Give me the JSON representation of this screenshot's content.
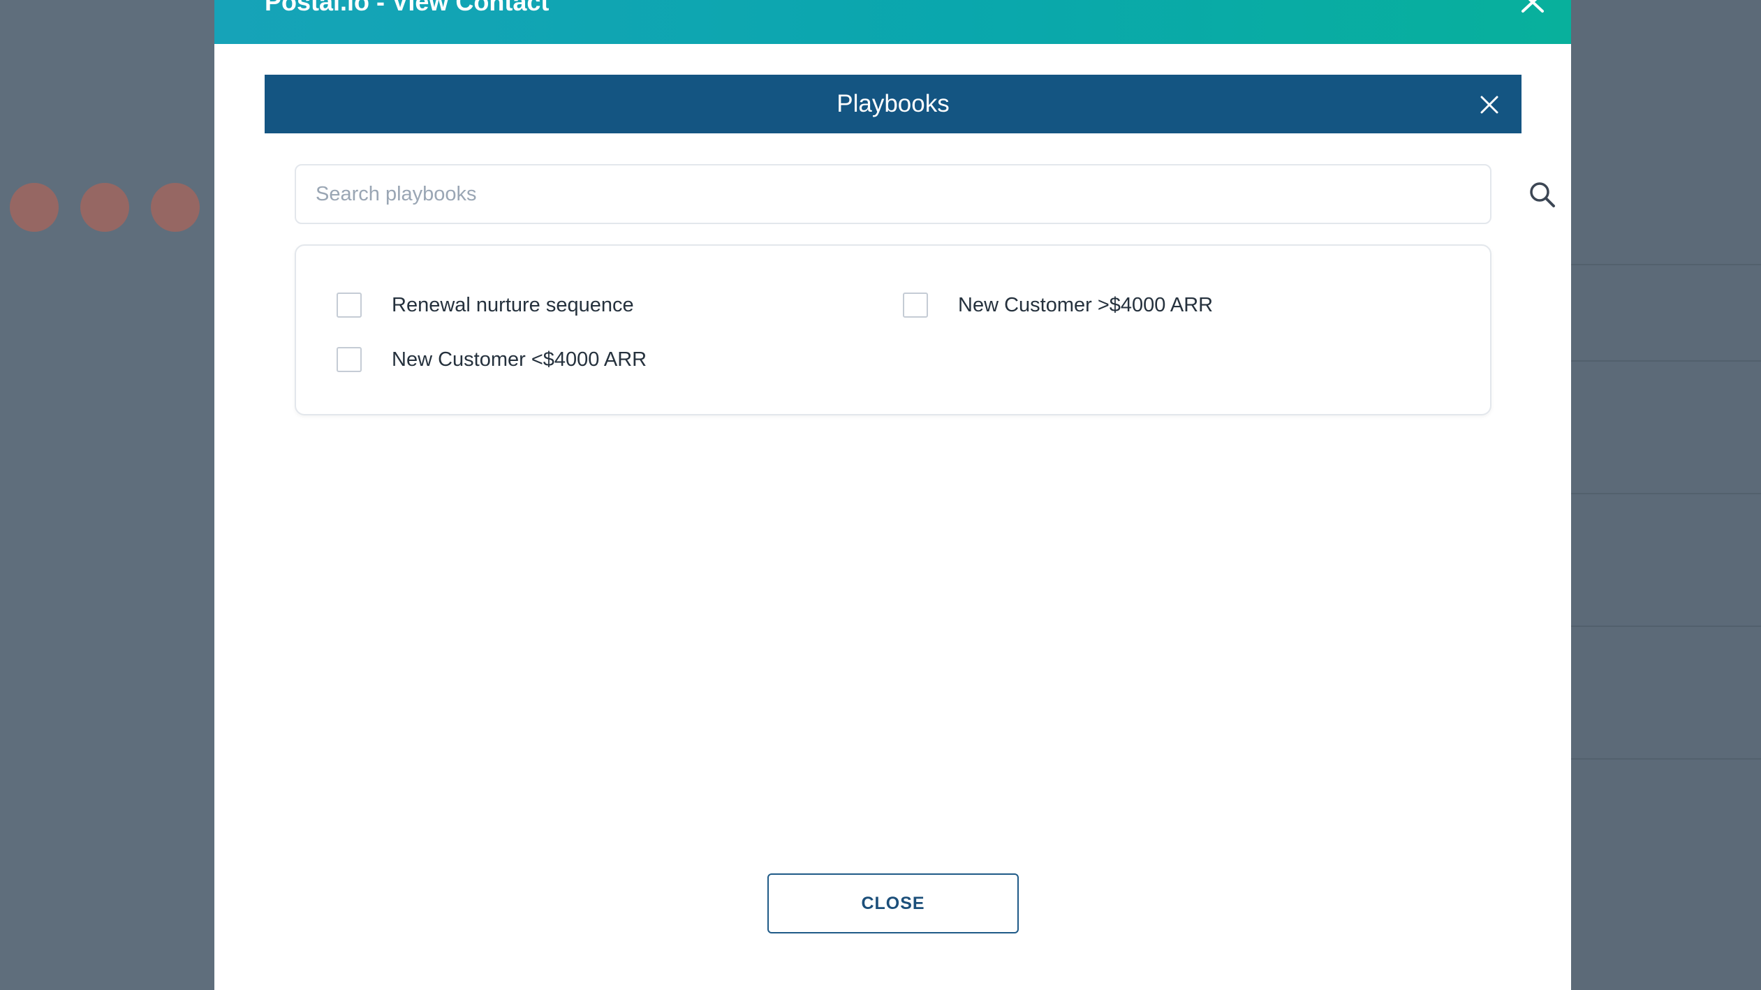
{
  "outer_modal": {
    "title": "Postal.io - View Contact"
  },
  "playbooks_modal": {
    "title": "Playbooks",
    "search": {
      "placeholder": "Search playbooks",
      "value": ""
    },
    "items": [
      {
        "label": "Renewal nurture sequence",
        "checked": false
      },
      {
        "label": "New Customer >$4000 ARR",
        "checked": false
      },
      {
        "label": "New Customer <$4000 ARR",
        "checked": false
      }
    ],
    "close_label": "CLOSE"
  },
  "colors": {
    "header_gradient_start": "#16a3b8",
    "header_gradient_end": "#08b09c",
    "panel_header": "#145582",
    "button_border": "#1f5a87",
    "overlay": "#5f6e7c"
  },
  "icons": {
    "outer_close": "close-icon",
    "inner_close": "close-icon",
    "search": "search-icon"
  }
}
